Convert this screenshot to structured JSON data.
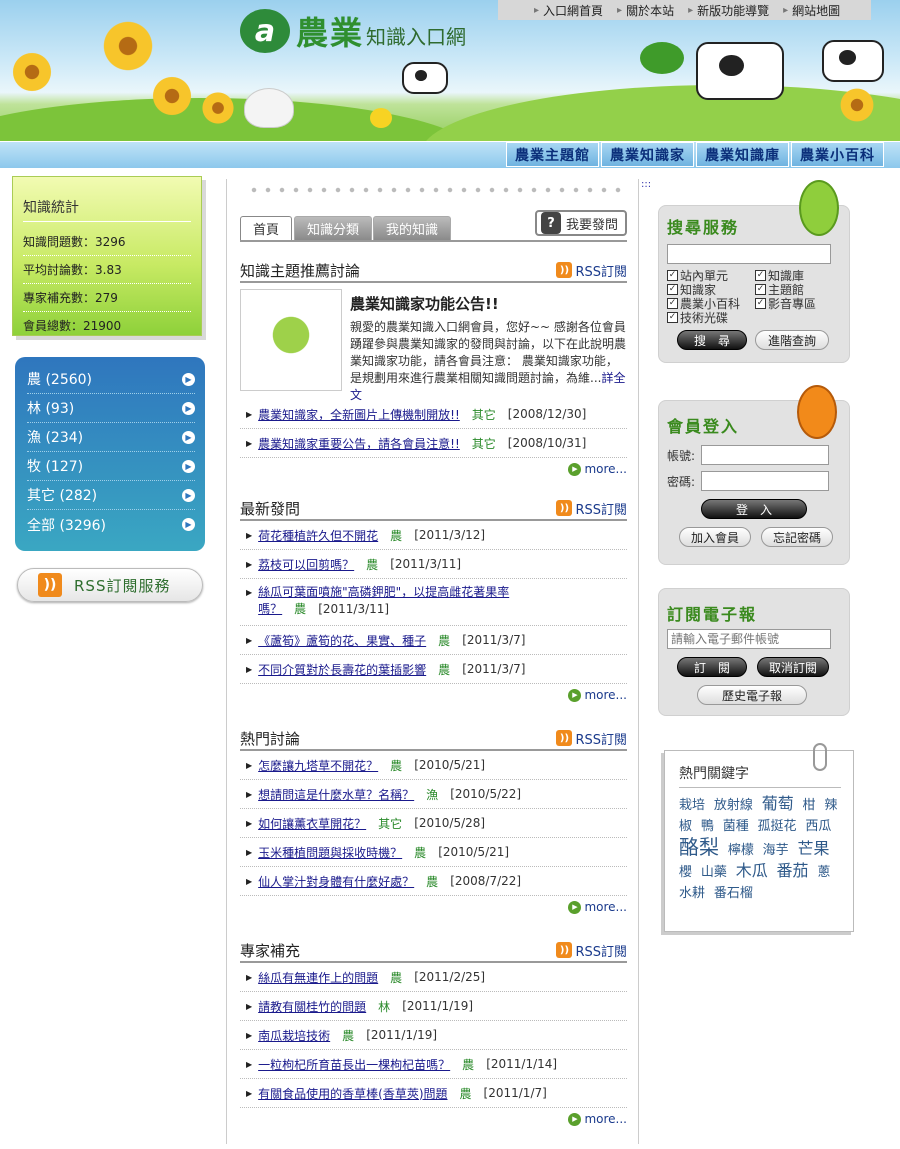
{
  "header": {
    "logo_text_big": "農業",
    "logo_text_small": "知識入口網",
    "top_nav": [
      "入口網首頁",
      "關於本站",
      "新版功能導覽",
      "網站地圖"
    ],
    "main_nav": [
      "農業主題館",
      "農業知識家",
      "農業知識庫",
      "農業小百科"
    ]
  },
  "stats": {
    "title": "知識統計",
    "items": [
      "知識問題數：3296",
      "平均討論數：3.83",
      "專家補充數：279",
      "會員總數：21900"
    ]
  },
  "categories": [
    {
      "label": "農 (2560)"
    },
    {
      "label": "林 (93)"
    },
    {
      "label": "漁 (234)"
    },
    {
      "label": "牧 (127)"
    },
    {
      "label": "其它 (282)"
    },
    {
      "label": "全部 (3296)"
    }
  ],
  "rss_service": "RSS訂閱服務",
  "tabs": [
    "首頁",
    "知識分類",
    "我的知識"
  ],
  "ask_button": "我要發問",
  "rss_label": "RSS訂閱",
  "more_label": "more...",
  "featured": {
    "title": "知識主題推薦討論",
    "ann_title": "農業知識家功能公告!!",
    "ann_body": "親愛的農業知識入口網會員，您好~~ 感謝各位會員踴躍參與農業知識家的發問與討論，以下在此說明農業知識家功能，請各會員注意： 農業知識家功能，是規劃用來進行農業相關知識問題討論，為維...",
    "ann_link": "詳全文",
    "items": [
      {
        "title": "農業知識家，全新圖片上傳機制開放!!",
        "cat": "其它",
        "date": "[2008/12/30]"
      },
      {
        "title": "農業知識家重要公告，請各會員注意!!",
        "cat": "其它",
        "date": "[2008/10/31]"
      }
    ]
  },
  "latest": {
    "title": "最新發問",
    "items": [
      {
        "title": "荷花種植許久但不開花",
        "cat": "農",
        "date": "[2011/3/12]"
      },
      {
        "title": "荔枝可以回剪嗎？",
        "cat": "農",
        "date": "[2011/3/11]"
      },
      {
        "title": "絲瓜可葉面噴施\"高磷鉀肥\"，以提高雌花著果率嗎？",
        "cat": "農",
        "date": "[2011/3/11]"
      },
      {
        "title": "《蘆筍》蘆筍的花、果實、種子",
        "cat": "農",
        "date": "[2011/3/7]"
      },
      {
        "title": "不同介質對於長壽花的葉插影響",
        "cat": "農",
        "date": "[2011/3/7]"
      }
    ]
  },
  "hot": {
    "title": "熱門討論",
    "items": [
      {
        "title": "怎麼讓九塔草不開花？",
        "cat": "農",
        "date": "[2010/5/21]"
      },
      {
        "title": "想請問這是什麼水草？名稱？",
        "cat": "漁",
        "date": "[2010/5/22]"
      },
      {
        "title": "如何讓薰衣草開花？",
        "cat": "其它",
        "date": "[2010/5/28]"
      },
      {
        "title": "玉米種植問題與採收時機？",
        "cat": "農",
        "date": "[2010/5/21]"
      },
      {
        "title": "仙人掌汁對身體有什麼好處？",
        "cat": "農",
        "date": "[2008/7/22]"
      }
    ]
  },
  "expert": {
    "title": "專家補充",
    "items": [
      {
        "title": "絲瓜有無連作上的問題",
        "cat": "農",
        "date": "[2011/2/25]"
      },
      {
        "title": "請教有關桂竹的問題",
        "cat": "林",
        "date": "[2011/1/19]"
      },
      {
        "title": "南瓜栽培技術",
        "cat": "農",
        "date": "[2011/1/19]"
      },
      {
        "title": "一粒枸杞所育苗長出一棵枸杞苗嗎？",
        "cat": "農",
        "date": "[2011/1/14]"
      },
      {
        "title": "有關食品使用的香草棒(香草莢)問題",
        "cat": "農",
        "date": "[2011/1/7]"
      }
    ]
  },
  "search": {
    "title": "搜尋服務",
    "input_value": "",
    "options": [
      "站內單元",
      "知識庫",
      "知識家",
      "主題館",
      "農業小百科",
      "影音專區",
      "技術光碟"
    ],
    "search_btn": "搜　尋",
    "advanced_btn": "進階查詢"
  },
  "login": {
    "title": "會員登入",
    "account_label": "帳號:",
    "password_label": "密碼:",
    "login_btn": "登　入",
    "join_btn": "加入會員",
    "forgot_btn": "忘記密碼"
  },
  "newsletter": {
    "title": "訂閱電子報",
    "email_placeholder": "請輸入電子郵件帳號",
    "subscribe_btn": "訂　閱",
    "unsubscribe_btn": "取消訂閱",
    "history_btn": "歷史電子報"
  },
  "keywords": {
    "title": "熱門關鍵字",
    "words": [
      "栽培",
      "放射線",
      "葡萄",
      "柑",
      "辣椒",
      "鴨",
      "菌種",
      "孤挺花",
      "西瓜",
      "酪梨",
      "檸檬",
      "海芋",
      "芒果",
      "櫻",
      "山藥",
      "木瓜",
      "番茄",
      "蔥",
      "水耕",
      "番石榴"
    ]
  },
  "colors": {
    "accent_green": "#3a8a1e",
    "nav_blue": "#0b2f7a",
    "link": "#1a1a8c"
  }
}
